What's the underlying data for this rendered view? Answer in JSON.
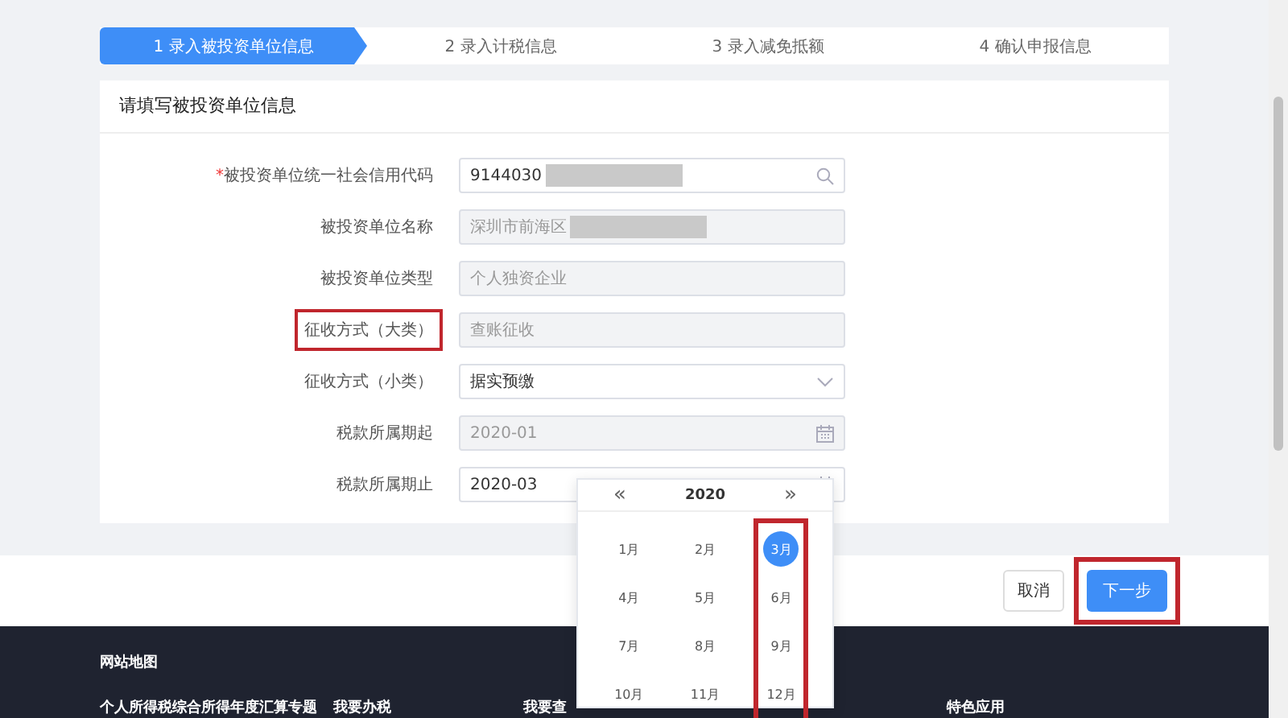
{
  "steps": [
    {
      "label": "1 录入被投资单位信息",
      "selected": true
    },
    {
      "label": "2 录入计税信息",
      "selected": false
    },
    {
      "label": "3 录入减免抵额",
      "selected": false
    },
    {
      "label": "4 确认申报信息",
      "selected": false
    }
  ],
  "section": {
    "title": "请填写被投资单位信息",
    "required_mark": "*",
    "fields": [
      {
        "label": "被投资单位统一社会信用代码",
        "required": true,
        "kind": "search",
        "value": "9144030",
        "redacted": true,
        "disabled": false,
        "highlighted": false
      },
      {
        "label": "被投资单位名称",
        "required": false,
        "kind": "text",
        "value": "深圳市前海区",
        "redacted": true,
        "disabled": true,
        "highlighted": false
      },
      {
        "label": "被投资单位类型",
        "required": false,
        "kind": "text",
        "value": "个人独资企业",
        "redacted": false,
        "disabled": true,
        "highlighted": false
      },
      {
        "label": "征收方式（大类）",
        "required": false,
        "kind": "text",
        "value": "查账征收",
        "redacted": false,
        "disabled": true,
        "highlighted": true
      },
      {
        "label": "征收方式（小类）",
        "required": false,
        "kind": "select",
        "value": "据实预缴",
        "redacted": false,
        "disabled": false,
        "highlighted": false
      },
      {
        "label": "税款所属期起",
        "required": false,
        "kind": "date",
        "value": "2020-01",
        "redacted": false,
        "disabled": true,
        "highlighted": false
      },
      {
        "label": "税款所属期止",
        "required": false,
        "kind": "date",
        "value": "2020-03",
        "redacted": false,
        "disabled": false,
        "highlighted": false
      }
    ]
  },
  "month_picker": {
    "prev": "«",
    "year": "2020",
    "next": "»",
    "columns": [
      {
        "highlighted": false,
        "months": [
          {
            "label": "1月",
            "selected": false
          },
          {
            "label": "4月",
            "selected": false
          },
          {
            "label": "7月",
            "selected": false
          },
          {
            "label": "10月",
            "selected": false
          }
        ]
      },
      {
        "highlighted": false,
        "months": [
          {
            "label": "2月",
            "selected": false
          },
          {
            "label": "5月",
            "selected": false
          },
          {
            "label": "8月",
            "selected": false
          },
          {
            "label": "11月",
            "selected": false
          }
        ]
      },
      {
        "highlighted": true,
        "months": [
          {
            "label": "3月",
            "selected": true
          },
          {
            "label": "6月",
            "selected": false
          },
          {
            "label": "9月",
            "selected": false
          },
          {
            "label": "12月",
            "selected": false
          }
        ]
      }
    ]
  },
  "actions": {
    "cancel": "取消",
    "next": "下一步",
    "next_highlighted": true
  },
  "footer": {
    "title": "网站地图",
    "links": [
      "个人所得税综合所得年度汇算专题",
      "我要办税",
      "我要查",
      "特色应用"
    ]
  }
}
